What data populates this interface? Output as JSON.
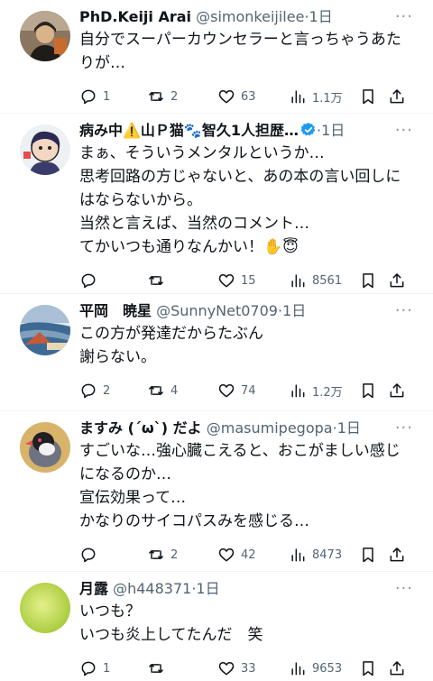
{
  "tweets": [
    {
      "name": "PhD.Keiji Arai",
      "handle": "@simonkeijilee",
      "time": "1日",
      "lines": [
        "自分でスーパーカウンセラーと言っちゃうあた",
        "りが…"
      ],
      "replies": "1",
      "retweets": "2",
      "likes": "63",
      "views": "1.1万",
      "verified": false,
      "avatar_color": "#6b5a48"
    },
    {
      "name": "病み中⚠️山Ｐ猫🐾智久1人担歴…",
      "handle": "",
      "time": "1日",
      "lines": [
        "まぁ、そういうメンタルというか…",
        "思考回路の方じゃないと、あの本の言い回しに",
        "はならないから。",
        "当然と言えば、当然のコメント…",
        "てかいつも通りなんかい！✋😇"
      ],
      "replies": "",
      "retweets": "",
      "likes": "15",
      "views": "8561",
      "verified": true,
      "avatar_color": "#e9eef2"
    },
    {
      "name": "平岡　暁星",
      "handle": "@SunnyNet0709",
      "time": "1日",
      "lines": [
        "この方が発達だからたぶん",
        "謝らない。"
      ],
      "replies": "2",
      "retweets": "4",
      "likes": "74",
      "views": "1.2万",
      "verified": false,
      "avatar_color": "#5a7da3"
    },
    {
      "name": "ますみ (´ω`) だよ",
      "handle": "@masumipegopa",
      "time": "1日",
      "lines": [
        "すごいな…強心臓こえると、おこがましい感じ",
        "になるのか…",
        "宣伝効果って…",
        "かなりのサイコパスみを感じる…"
      ],
      "replies": "",
      "retweets": "2",
      "likes": "42",
      "views": "8473",
      "verified": false,
      "avatar_color": "#c9a45a"
    },
    {
      "name": "月露",
      "handle": "@h448371",
      "time": "1日",
      "lines": [
        "いつも？",
        "いつも炎上してたんだ　笑"
      ],
      "replies": "1",
      "retweets": "",
      "likes": "33",
      "views": "9653",
      "verified": false,
      "avatar_color": "#c6df4a"
    }
  ],
  "icons": {
    "reply": "reply-icon",
    "retweet": "retweet-icon",
    "like": "heart-icon",
    "views": "views-icon",
    "bookmark": "bookmark-icon",
    "share": "share-icon",
    "more": "more-icon"
  },
  "colors": {
    "text": "#0f1419",
    "muted": "#536471",
    "divider": "#eff3f4",
    "verified": "#1d9bf0"
  }
}
